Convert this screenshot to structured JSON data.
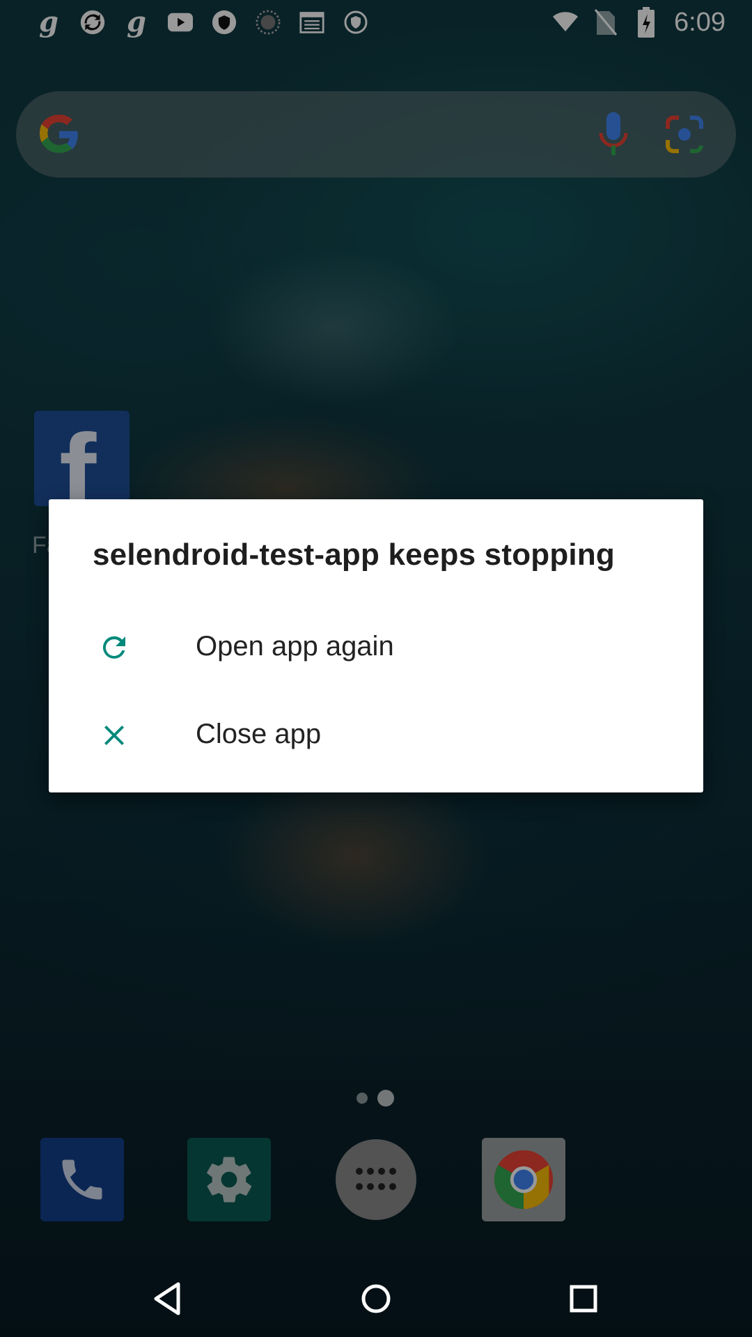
{
  "status_bar": {
    "time": "6:09",
    "left_icons": [
      "g-app-icon",
      "sync-app-icon",
      "g-app-icon",
      "youtube-icon",
      "shield-icon",
      "loading-icon",
      "calendar-icon",
      "vpn-shield-icon"
    ],
    "right_icons": [
      "wifi-icon",
      "no-sim-icon",
      "battery-charging-icon"
    ]
  },
  "search": {
    "icons": [
      "google-g-icon",
      "mic-icon",
      "lens-camera-icon"
    ]
  },
  "home": {
    "shortcut_label": "Fa"
  },
  "dock": [
    "phone-icon",
    "settings-icon",
    "app-drawer-icon",
    "chrome-icon"
  ],
  "dialog": {
    "title": "selendroid-test-app keeps stopping",
    "options": [
      {
        "label": "Open app again",
        "icon": "refresh-icon"
      },
      {
        "label": "Close app",
        "icon": "close-icon"
      }
    ],
    "accent": "#00897b"
  },
  "nav": [
    "back-icon",
    "home-icon",
    "recents-icon"
  ]
}
